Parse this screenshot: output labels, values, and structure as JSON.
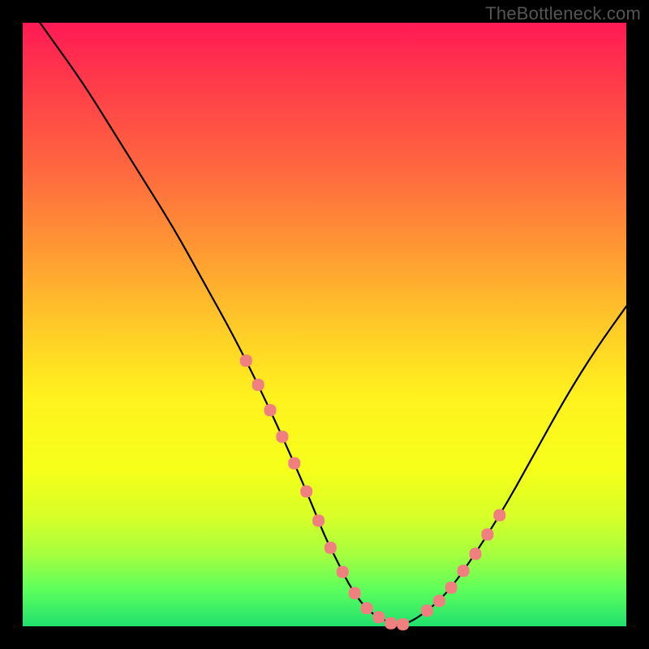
{
  "watermark": "TheBottleneck.com",
  "colors": {
    "bg": "#000000",
    "curve": "#000000",
    "marker": "#f08080"
  },
  "chart_data": {
    "type": "line",
    "title": "",
    "xlabel": "",
    "ylabel": "",
    "xlim": [
      0,
      100
    ],
    "ylim": [
      0,
      100
    ],
    "grid": false,
    "series": [
      {
        "name": "bottleneck-curve",
        "x": [
          0,
          5,
          10,
          15,
          20,
          25,
          30,
          35,
          40,
          45,
          48,
          50,
          52,
          54,
          56,
          58,
          60,
          62,
          65,
          70,
          75,
          80,
          85,
          90,
          95,
          100
        ],
        "y": [
          104,
          97,
          90,
          82,
          74,
          66,
          57,
          48,
          38,
          27,
          20,
          15,
          11,
          7,
          4,
          2,
          1,
          0,
          1,
          5,
          12,
          20,
          29,
          38,
          46,
          53
        ]
      }
    ],
    "markers": {
      "comment": "Scatter dots shown near the valley of the curve (approximate x positions along the same curve).",
      "x": [
        37,
        39,
        41,
        43,
        45,
        47,
        49,
        51,
        53,
        55,
        57,
        59,
        61,
        63,
        67,
        69,
        71,
        73,
        75,
        77,
        79
      ]
    }
  }
}
